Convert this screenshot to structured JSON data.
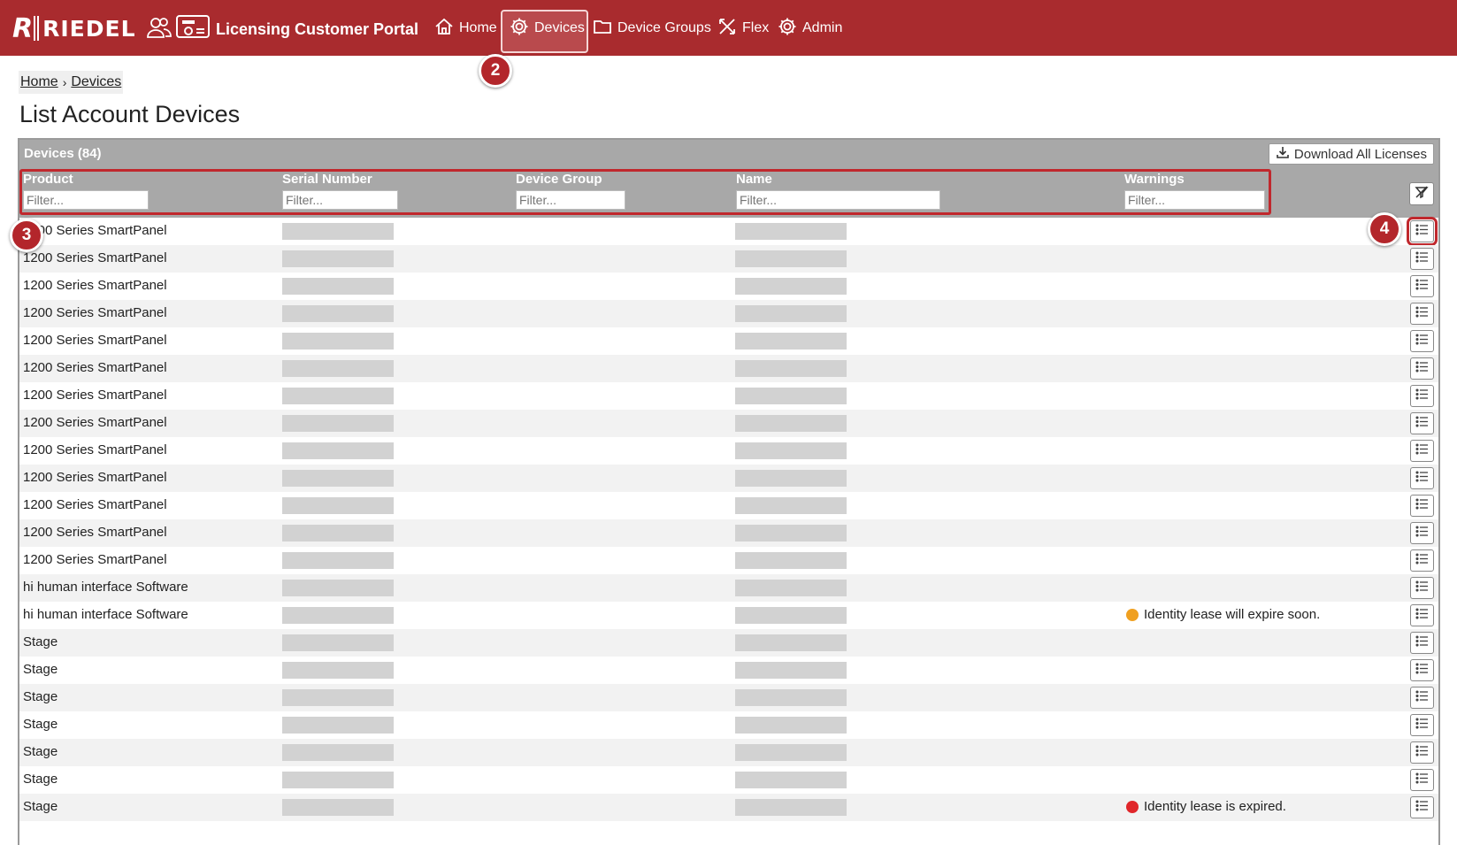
{
  "brand": {
    "logo_text": "RIEDEL",
    "logo_mark": "R"
  },
  "portal": {
    "title": "Licensing Customer Portal"
  },
  "nav": [
    {
      "label": "Home",
      "icon": "home-icon"
    },
    {
      "label": "Devices",
      "icon": "gear-icon",
      "active": true
    },
    {
      "label": "Device Groups",
      "icon": "folder-icon"
    },
    {
      "label": "Flex",
      "icon": "flex-icon"
    },
    {
      "label": "Admin",
      "icon": "gear-icon"
    }
  ],
  "breadcrumb": {
    "home": "Home",
    "current": "Devices"
  },
  "page": {
    "title": "List Account Devices"
  },
  "panel": {
    "caption": "Devices (84)",
    "download_label": "Download All Licenses"
  },
  "columns": {
    "product": "Product",
    "serial": "Serial Number",
    "group": "Device Group",
    "name": "Name",
    "warnings": "Warnings"
  },
  "filter_placeholder": "Filter...",
  "callouts": {
    "c2": "2",
    "c3": "3",
    "c4": "4"
  },
  "rows": [
    {
      "product": "1200 Series SmartPanel",
      "warning": ""
    },
    {
      "product": "1200 Series SmartPanel",
      "warning": ""
    },
    {
      "product": "1200 Series SmartPanel",
      "warning": ""
    },
    {
      "product": "1200 Series SmartPanel",
      "warning": ""
    },
    {
      "product": "1200 Series SmartPanel",
      "warning": ""
    },
    {
      "product": "1200 Series SmartPanel",
      "warning": ""
    },
    {
      "product": "1200 Series SmartPanel",
      "warning": ""
    },
    {
      "product": "1200 Series SmartPanel",
      "warning": ""
    },
    {
      "product": "1200 Series SmartPanel",
      "warning": ""
    },
    {
      "product": "1200 Series SmartPanel",
      "warning": ""
    },
    {
      "product": "1200 Series SmartPanel",
      "warning": ""
    },
    {
      "product": "1200 Series SmartPanel",
      "warning": ""
    },
    {
      "product": "1200 Series SmartPanel",
      "warning": ""
    },
    {
      "product": "hi human interface Software",
      "warning": ""
    },
    {
      "product": "hi human interface Software",
      "warning": "Identity lease will expire soon.",
      "warning_color": "#f0a020"
    },
    {
      "product": "Stage",
      "warning": ""
    },
    {
      "product": "Stage",
      "warning": ""
    },
    {
      "product": "Stage",
      "warning": ""
    },
    {
      "product": "Stage",
      "warning": ""
    },
    {
      "product": "Stage",
      "warning": ""
    },
    {
      "product": "Stage",
      "warning": ""
    },
    {
      "product": "Stage",
      "warning": "Identity lease is expired.",
      "warning_color": "#e0262a"
    }
  ],
  "colors": {
    "brand_red": "#a92b2e",
    "header_gray": "#a8a8a8",
    "highlight": "#c0282d"
  }
}
